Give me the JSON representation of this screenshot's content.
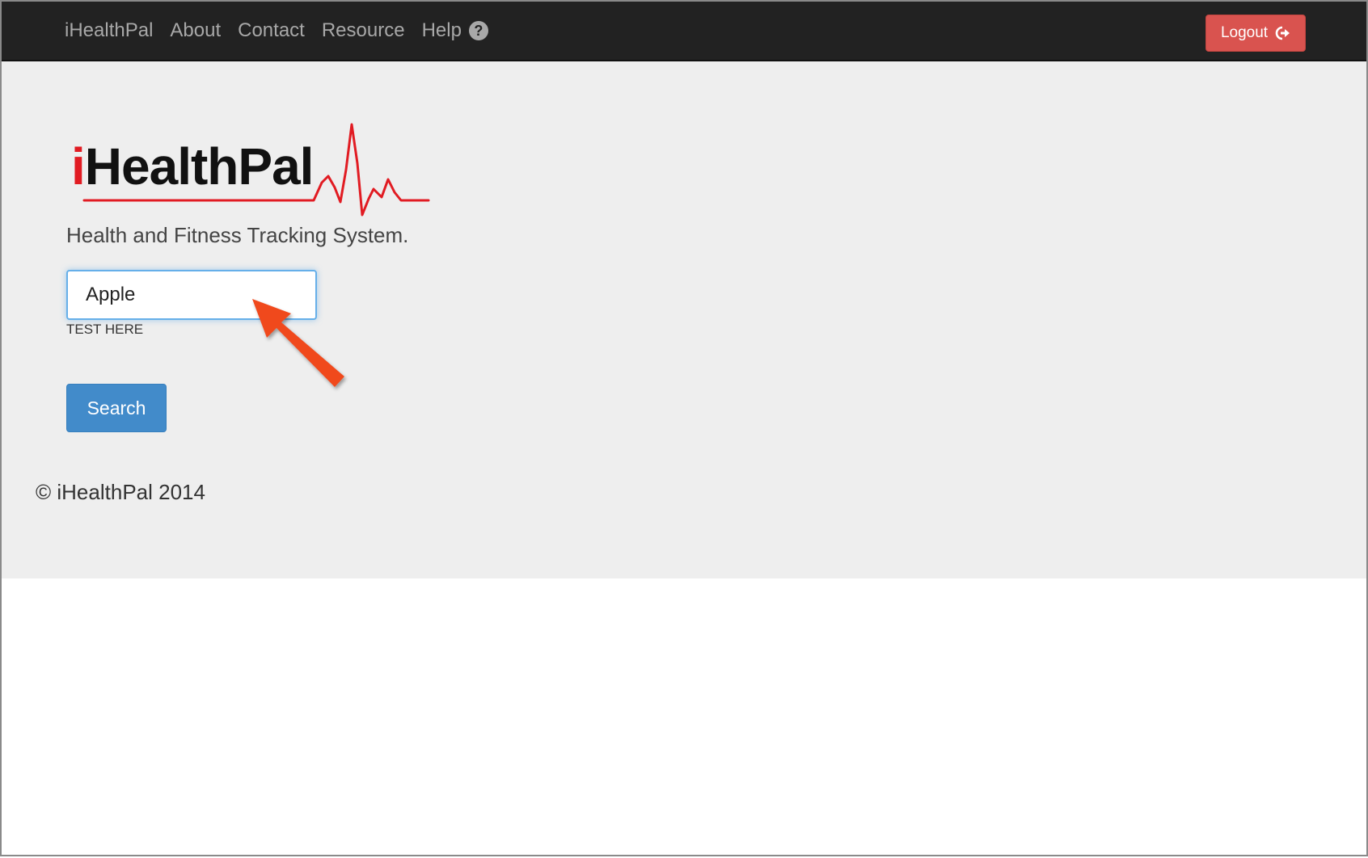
{
  "navbar": {
    "links": [
      "iHealthPal",
      "About",
      "Contact",
      "Resource",
      "Help"
    ],
    "help_icon": "question-circle-icon",
    "logout_label": "Logout",
    "logout_icon": "logout-icon"
  },
  "logo": {
    "prefix": "i",
    "rest": "HealthPal"
  },
  "main": {
    "tagline": "Health and Fitness Tracking System.",
    "search_value": "Apple",
    "help_text": "TEST HERE",
    "search_button": "Search"
  },
  "footer": {
    "copyright": "© iHealthPal 2014"
  },
  "colors": {
    "navbar_bg": "#222222",
    "logout": "#d9534f",
    "primary": "#428bca",
    "brand_red": "#e11b22",
    "annotation_arrow": "#f04a1e"
  }
}
